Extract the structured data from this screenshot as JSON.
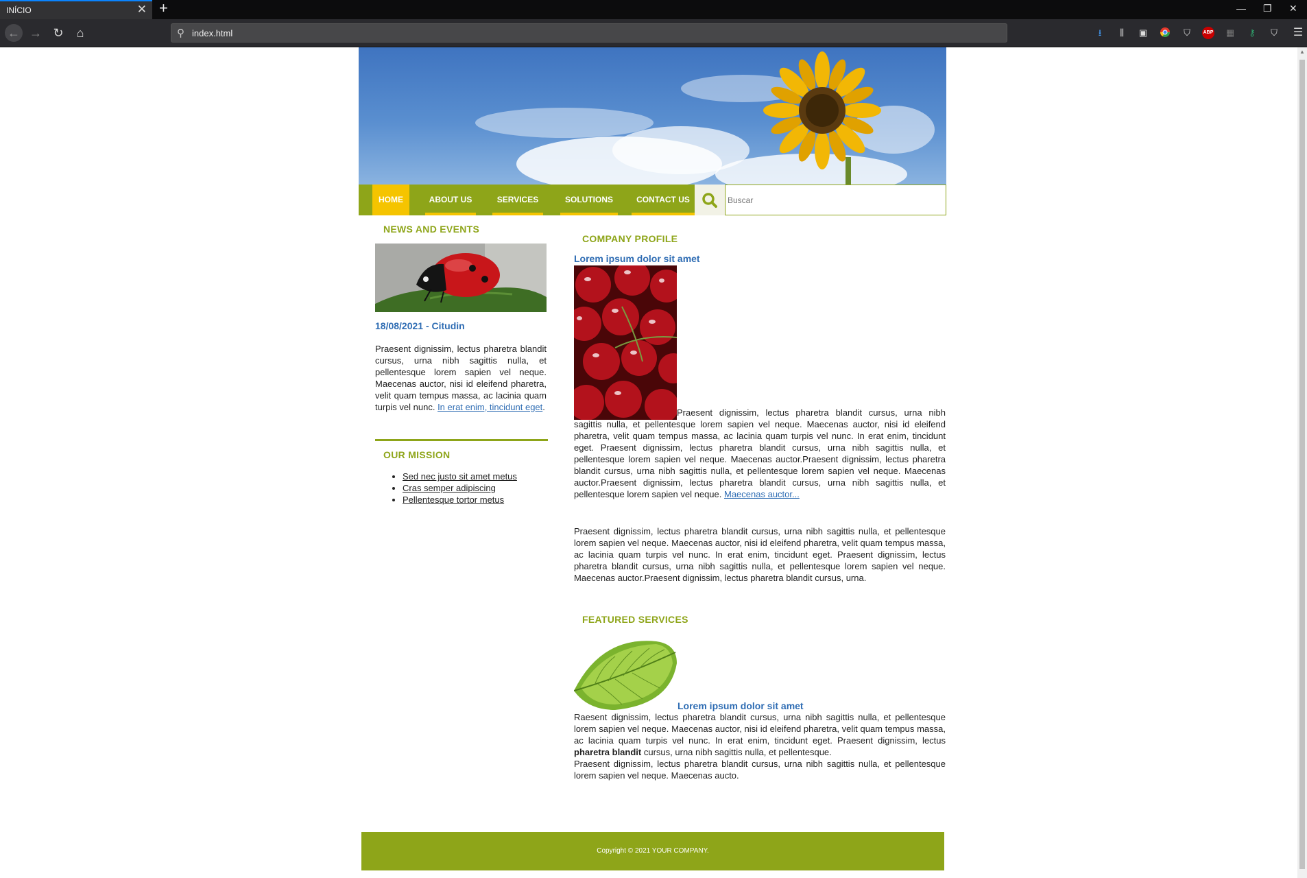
{
  "browser": {
    "tab_title": "INÍCIO",
    "tab_close": "✕",
    "new_tab": "+",
    "url": "index.html",
    "extensions": [
      "download-icon",
      "library-icon",
      "sidebar-icon",
      "chrome-icon",
      "shield-icon",
      "abp-icon",
      "extension-icon",
      "key-icon",
      "privacy-icon",
      "menu-icon"
    ]
  },
  "nav": {
    "items": [
      {
        "label": "HOME",
        "active": true
      },
      {
        "label": "ABOUT US"
      },
      {
        "label": "SERVICES"
      },
      {
        "label": "SOLUTIONS"
      },
      {
        "label": "CONTACT US"
      }
    ],
    "search_placeholder": "Buscar"
  },
  "sidebar": {
    "news_heading": "NEWS AND EVENTS",
    "news_date": "18/08/2021 - Citudin",
    "news_text": "Praesent dignissim, lectus pharetra blandit cursus, urna nibh sagittis nulla, et pellentesque lorem sapien vel neque. Maecenas auctor, nisi id eleifend pharetra, velit quam tempus massa, ac lacinia quam turpis vel nunc.",
    "news_link": "In erat enim, tincidunt eget",
    "news_link_tail": ".",
    "mission_heading": "OUR MISSION",
    "mission_items": [
      "Sed nec justo sit amet metus",
      "Cras semper adipiscing",
      "Pellentesque tortor metus"
    ]
  },
  "main": {
    "profile_heading": "COMPANY PROFILE",
    "profile_title": "Lorem ipsum dolor sit amet",
    "profile_text": "Praesent dignissim, lectus pharetra blandit cursus, urna nibh sagittis nulla, et pellentesque lorem sapien vel neque. Maecenas auctor, nisi id eleifend pharetra, velit quam tempus massa, ac lacinia quam turpis vel nunc. In erat enim, tincidunt eget. Praesent dignissim, lectus pharetra blandit cursus, urna nibh sagittis nulla, et pellentesque lorem sapien vel neque. Maecenas auctor.Praesent dignissim, lectus pharetra blandit cursus, urna nibh sagittis nulla, et pellentesque lorem sapien vel neque. Maecenas auctor.Praesent dignissim, lectus pharetra blandit cursus, urna nibh sagittis nulla, et pellentesque lorem sapien vel neque.",
    "profile_link": "Maecenas auctor...",
    "profile_text2": "Praesent dignissim, lectus pharetra blandit cursus, urna nibh sagittis nulla, et pellentesque lorem sapien vel neque. Maecenas auctor, nisi id eleifend pharetra, velit quam tempus massa, ac lacinia quam turpis vel nunc. In erat enim, tincidunt eget. Praesent dignissim, lectus pharetra blandit cursus, urna nibh sagittis nulla, et pellentesque lorem sapien vel neque. Maecenas auctor.Praesent dignissim, lectus pharetra blandit cursus, urna.",
    "featured_heading": "FEATURED SERVICES",
    "featured_title": "Lorem ipsum dolor sit amet",
    "featured_text_a": "Raesent dignissim, lectus pharetra blandit cursus, urna nibh sagittis nulla, et pellentesque lorem sapien vel neque. Maecenas auctor, nisi id eleifend pharetra, velit quam tempus massa, ac lacinia quam turpis vel nunc. In erat enim, tincidunt eget. Praesent dignissim, lectus",
    "featured_bold": "pharetra blandit",
    "featured_text_b": "cursus, urna nibh sagittis nulla, et pellentesque.",
    "featured_text_c": "Praesent dignissim, lectus pharetra blandit cursus, urna nibh sagittis nulla, et pellentesque lorem sapien vel neque. Maecenas aucto."
  },
  "footer": {
    "text": "Copyright © 2021 YOUR COMPANY."
  },
  "colors": {
    "accent": "#8ea519",
    "highlight": "#f5c400",
    "link": "#2e6cb3"
  }
}
